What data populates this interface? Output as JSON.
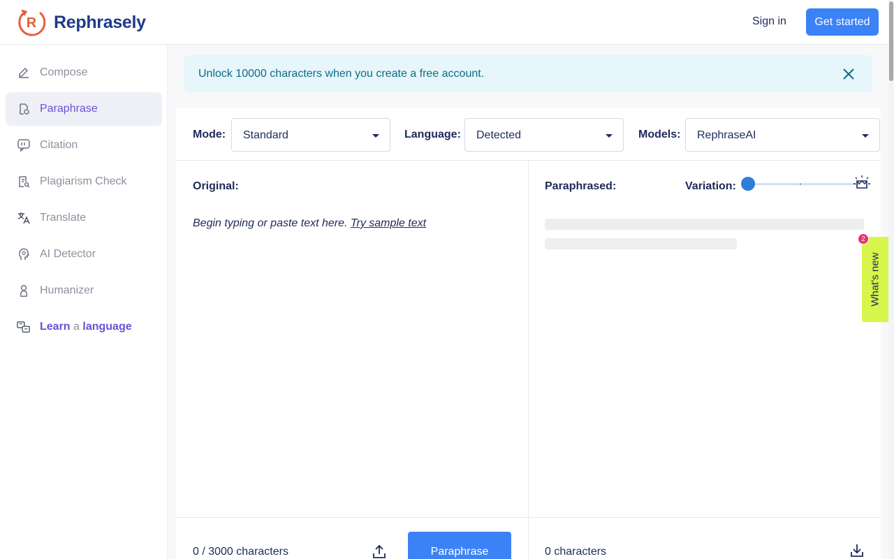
{
  "app": {
    "name": "Rephrasely",
    "logo_letter": "R",
    "brand_color": "#e85d3a",
    "accent": "#3b82f6"
  },
  "header": {
    "sign_in": "Sign in",
    "get_started": "Get started"
  },
  "sidebar": {
    "items": [
      {
        "label": "Compose",
        "icon": "pencil-icon",
        "active": false
      },
      {
        "label": "Paraphrase",
        "icon": "document-refresh-icon",
        "active": true
      },
      {
        "label": "Citation",
        "icon": "quote-bubble-icon",
        "active": false
      },
      {
        "label": "Plagiarism Check",
        "icon": "document-search-icon",
        "active": false
      },
      {
        "label": "Translate",
        "icon": "translate-icon",
        "active": false
      },
      {
        "label": "AI Detector",
        "icon": "brain-icon",
        "active": false
      },
      {
        "label": "Humanizer",
        "icon": "person-icon",
        "active": false
      }
    ],
    "learn": {
      "pre": "Learn",
      "mid": "a",
      "post": "language",
      "icon": "language-cards-icon"
    }
  },
  "banner": {
    "text": "Unlock 10000 characters when you create a free account."
  },
  "toolbar": {
    "mode_label": "Mode:",
    "mode_value": "Standard",
    "language_label": "Language:",
    "language_value": "Detected",
    "models_label": "Models:",
    "models_value": "RephraseAI"
  },
  "original": {
    "title": "Original:",
    "placeholder": "Begin typing or paste text here.",
    "try_sample": "Try sample text",
    "char_count": "0 / 3000 characters"
  },
  "paraphrased": {
    "title": "Paraphrased:",
    "variation_label": "Variation:",
    "variation_level": 0,
    "char_count": "0 characters"
  },
  "actions": {
    "paraphrase": "Paraphrase"
  },
  "whats_new": {
    "label": "What's new",
    "badge": "2"
  }
}
